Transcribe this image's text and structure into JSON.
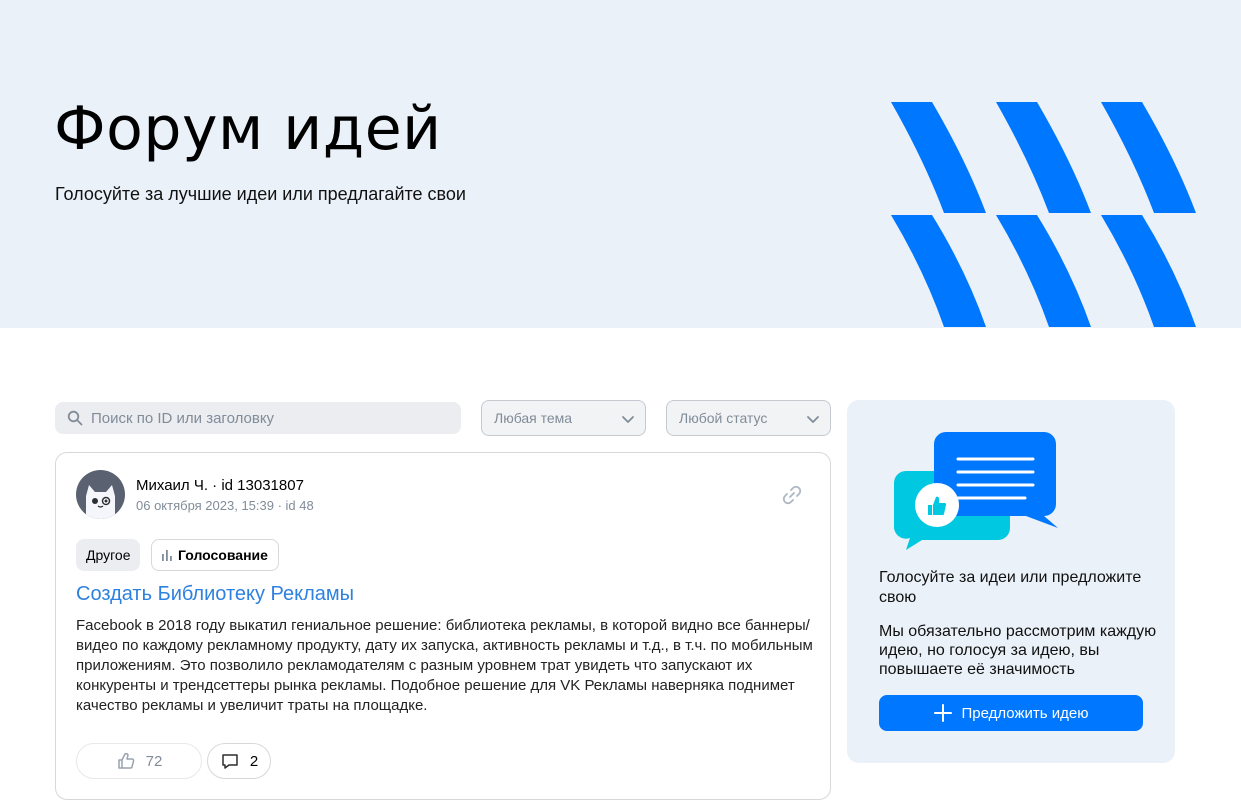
{
  "hero": {
    "title": "Форум идей",
    "subtitle": "Голосуйте за лучшие идеи или предлагайте свои",
    "accent_color": "#0077ff"
  },
  "filters": {
    "search_placeholder": "Поиск по ID или заголовку",
    "topic_select": "Любая тема",
    "status_select": "Любой статус"
  },
  "idea": {
    "author": "Михаил Ч. · id 13031807",
    "meta": "06 октября 2023, 15:39 · id 48",
    "tags": [
      "Другое",
      "Голосование"
    ],
    "title": "Создать Библиотеку Рекламы",
    "body": "Facebook в 2018 году выкатил гениальное решение: библиотека рекламы, в которой видно все баннеры/видео по каждому рекламному продукту, дату их запуска, активность рекламы и т.д., в т.ч. по мобильным приложениям. Это позволило рекламодателям с разным уровнем трат увидеть что запускают их конкуренты и трендсеттеры рынка рекламы. Подобное решение для VK Рекламы наверняка поднимет качество рекламы и увеличит траты на площадке.",
    "likes": "72",
    "comments": "2"
  },
  "aside": {
    "heading": "Голосуйте за идеи или предложите свою",
    "text": "Мы обязательно рассмотрим каждую идею, но голосуя за идею, вы повышаете её значимость",
    "button": "Предложить идею"
  }
}
